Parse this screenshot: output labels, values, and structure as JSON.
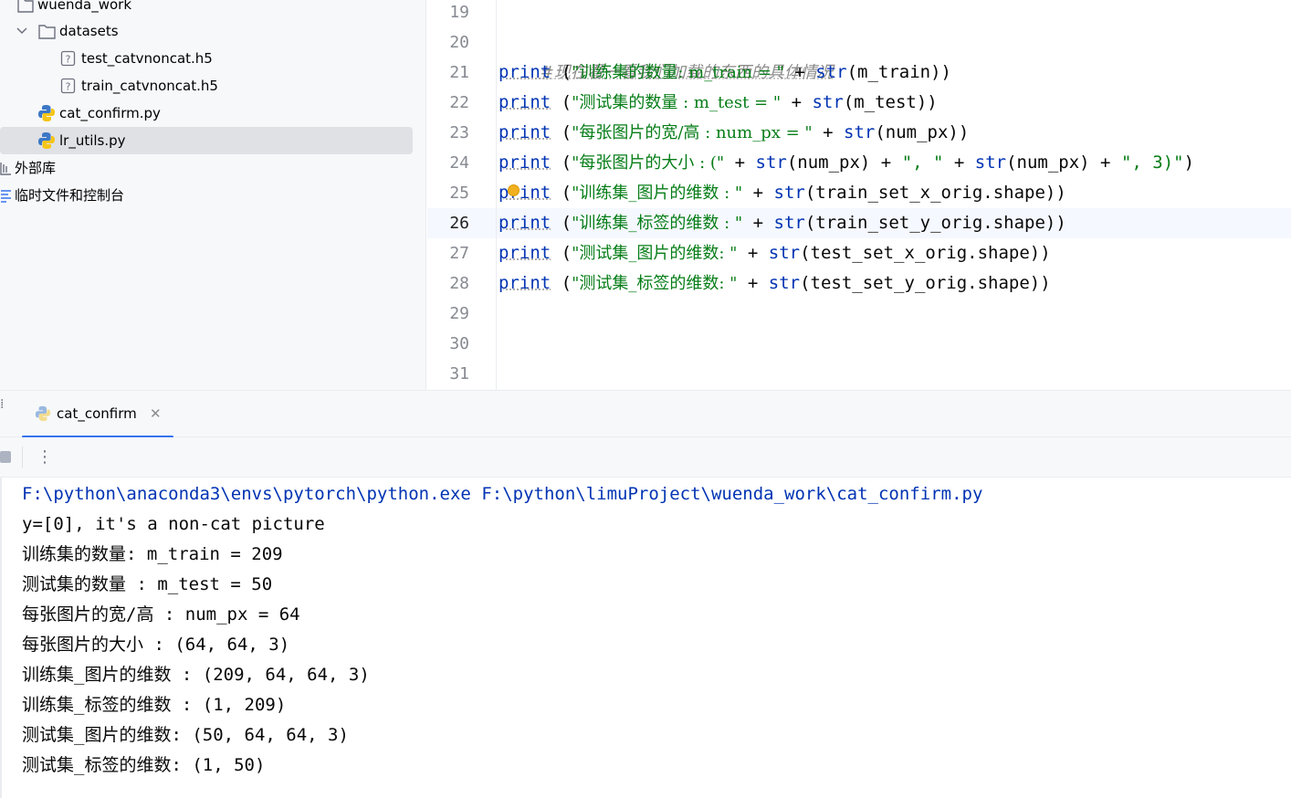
{
  "project_tree": {
    "root_folder": "wuenda_work",
    "datasets_folder": "datasets",
    "file_test_h5": "test_catvnoncat.h5",
    "file_train_h5": "train_catvnoncat.h5",
    "file_cat_confirm": "cat_confirm.py",
    "file_lr_utils": "lr_utils.py",
    "external_libraries": "外部库",
    "scratches_consoles": "临时文件和控制台"
  },
  "editor": {
    "line_numbers": [
      "19",
      "20",
      "21",
      "22",
      "23",
      "24",
      "25",
      "26",
      "27",
      "28",
      "29",
      "30",
      "31"
    ],
    "active_line": "26",
    "comment": "#现在看一看我们加载的东西的具体情况",
    "print_kw": "print",
    "str_fn": "str",
    "code": [
      {
        "s1": "\"训练集的数量: m_train = \"",
        "rest": " + ",
        "arg": "(m_train))"
      },
      {
        "s1": "\"测试集的数量 : m_test = \"",
        "rest": " + ",
        "arg": "(m_test))"
      },
      {
        "s1": "\"每张图片的宽/高 : num_px = \"",
        "rest": " + ",
        "arg": "(num_px))"
      },
      {
        "s1": "\"每张图片的大小 : (\"",
        "rest": " + ",
        "arg": "(num_px) + ",
        "s2": "\", \"",
        "rest2": " + ",
        "arg2": "(num_px) + ",
        "s3": "\", 3)\"",
        "end": ")"
      },
      {
        "s1": "\"训练集_图片的维数 : \"",
        "rest": " + ",
        "arg": "(train_set_x_orig.shape))"
      },
      {
        "s1": "\"训练集_标签的维数 : \"",
        "rest": " + ",
        "arg": "(train_set_y_orig.shape))"
      },
      {
        "s1": "\"测试集_图片的维数: \"",
        "rest": " + ",
        "arg": "(test_set_x_orig.shape))"
      },
      {
        "s1": "\"测试集_标签的维数: \"",
        "rest": " + ",
        "arg": "(test_set_y_orig.shape))"
      }
    ]
  },
  "run_panel": {
    "tab_label": "cat_confirm",
    "menu_glyph": "⋮",
    "output": [
      "F:\\python\\anaconda3\\envs\\pytorch\\python.exe F:\\python\\limuProject\\wuenda_work\\cat_confirm.py",
      "y=[0], it's a non-cat picture",
      "训练集的数量: m_train = 209",
      "测试集的数量 : m_test = 50",
      "每张图片的宽/高 : num_px = 64",
      "每张图片的大小 : (64, 64, 3)",
      "训练集_图片的维数 : (209, 64, 64, 3)",
      "训练集_标签的维数 : (1, 209)",
      "测试集_图片的维数: (50, 64, 64, 3)",
      "测试集_标签的维数: (1, 50)"
    ]
  },
  "icons": {
    "folder": "folder-icon",
    "unknown_file": "unknown-file-icon",
    "python_file": "python-file-icon",
    "library": "library-icon",
    "scratches": "scratches-icon",
    "chevron": "chevron-down-icon",
    "close": "close-icon",
    "stop": "stop-icon",
    "more": "more-vertical-icon",
    "intention_bulb": "intention-bulb-icon"
  },
  "colors": {
    "keyword": "#0033b3",
    "string": "#067d17",
    "comment": "#8c8c8c",
    "selection": "#dfe1e5",
    "tab_underline": "#3574f0"
  }
}
